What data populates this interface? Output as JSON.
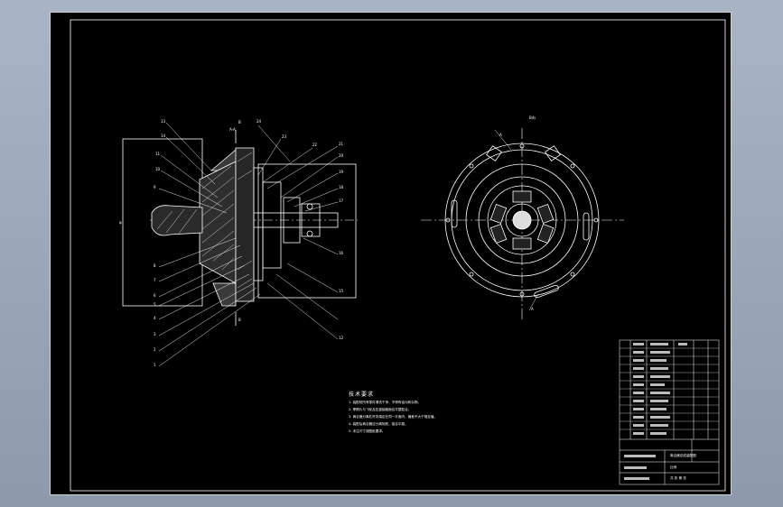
{
  "drawing": {
    "section_mark_letter": "A",
    "section_view_title": "A-A",
    "end_view_title": "B向",
    "section_marks_side": [
      "B",
      "B"
    ],
    "balloons_left": [
      "13",
      "14",
      "11",
      "10",
      "9",
      "8",
      "7",
      "6",
      "5",
      "4",
      "3",
      "2",
      "1"
    ],
    "balloons_right": [
      "24",
      "23",
      "22",
      "21",
      "20",
      "19",
      "18",
      "17",
      "16",
      "15",
      "12"
    ],
    "dimension_label": "φ"
  },
  "technical_requirements": {
    "title": "技术要求",
    "items": [
      "1. 装配前所有零件清洗干净，不得有油污和杂物。",
      "2. 摩擦片与飞轮及压盘接触面应平整贴合。",
      "3. 离合器分离杠杆内端应在同一平面内，偏差不大于规定值。",
      "4. 装配后离合器应分离彻底，接合平稳。",
      "5. 未注尺寸按图纸要求。"
    ]
  },
  "title_block": {
    "drawing_name": "离合器总成装配图",
    "scale_label": "比例",
    "sheet_label": "共 张 第 张"
  }
}
